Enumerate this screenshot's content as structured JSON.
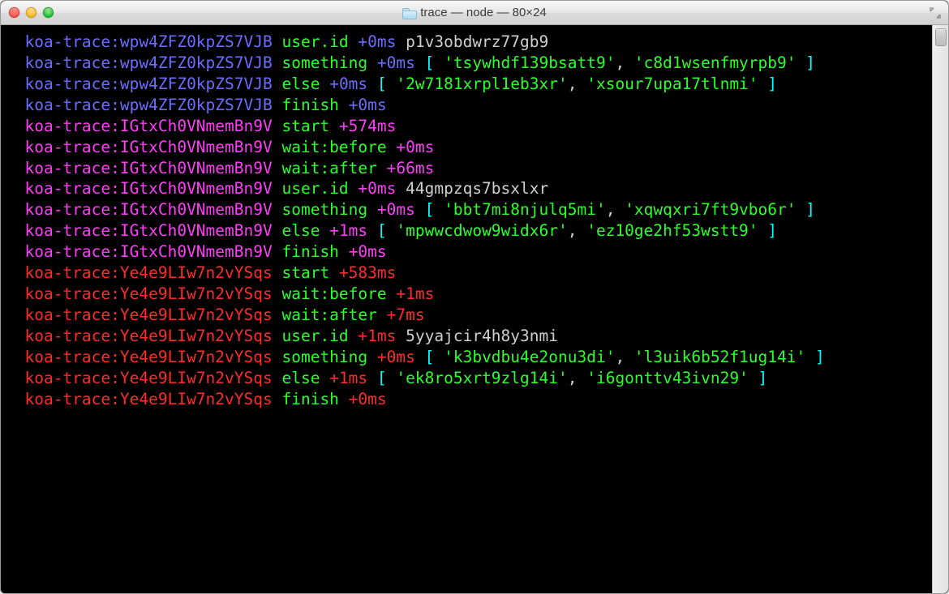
{
  "window": {
    "title": "trace — node — 80×24"
  },
  "colors": {
    "namespace_a": "#6a6dff",
    "namespace_b": "#ff3df8",
    "namespace_c": "#ff2b2b",
    "event": "#2bff2b",
    "timing_a": "#6a6dff",
    "timing_b": "#ff3df8",
    "timing_c": "#ff2b2b",
    "bracket": "#00ffff",
    "string": "#2bff2b",
    "plain": "#cfcfcf"
  },
  "log": [
    {
      "ns": "koa-trace:wpw4ZFZ0kpZS7VJB",
      "ns_color": "namespace_a",
      "event": "user.id",
      "timing": "+0ms",
      "payload_type": "plain",
      "plain": "p1v3obdwrz77gb9"
    },
    {
      "ns": "koa-trace:wpw4ZFZ0kpZS7VJB",
      "ns_color": "namespace_a",
      "event": "something",
      "timing": "+0ms",
      "payload_type": "array",
      "items": [
        "tsywhdf139bsatt9",
        "c8d1wsenfmyrpb9"
      ]
    },
    {
      "ns": "koa-trace:wpw4ZFZ0kpZS7VJB",
      "ns_color": "namespace_a",
      "event": "else",
      "timing": "+0ms",
      "payload_type": "array",
      "items": [
        "2w7181xrpl1eb3xr",
        "xsour7upa17tlnmi"
      ]
    },
    {
      "ns": "koa-trace:wpw4ZFZ0kpZS7VJB",
      "ns_color": "namespace_a",
      "event": "finish",
      "timing": "+0ms",
      "payload_type": "none"
    },
    {
      "ns": "koa-trace:IGtxCh0VNmemBn9V",
      "ns_color": "namespace_b",
      "event": "start",
      "timing": "+574ms",
      "payload_type": "none"
    },
    {
      "ns": "koa-trace:IGtxCh0VNmemBn9V",
      "ns_color": "namespace_b",
      "event": "wait:before",
      "timing": "+0ms",
      "payload_type": "none"
    },
    {
      "ns": "koa-trace:IGtxCh0VNmemBn9V",
      "ns_color": "namespace_b",
      "event": "wait:after",
      "timing": "+66ms",
      "payload_type": "none"
    },
    {
      "ns": "koa-trace:IGtxCh0VNmemBn9V",
      "ns_color": "namespace_b",
      "event": "user.id",
      "timing": "+0ms",
      "payload_type": "plain",
      "plain": "44gmpzqs7bsxlxr"
    },
    {
      "ns": "koa-trace:IGtxCh0VNmemBn9V",
      "ns_color": "namespace_b",
      "event": "something",
      "timing": "+0ms",
      "payload_type": "array",
      "items": [
        "bbt7mi8njulq5mi",
        "xqwqxri7ft9vbo6r"
      ]
    },
    {
      "ns": "koa-trace:IGtxCh0VNmemBn9V",
      "ns_color": "namespace_b",
      "event": "else",
      "timing": "+1ms",
      "payload_type": "array",
      "items": [
        "mpwwcdwow9widx6r",
        "ez10ge2hf53wstt9"
      ]
    },
    {
      "ns": "koa-trace:IGtxCh0VNmemBn9V",
      "ns_color": "namespace_b",
      "event": "finish",
      "timing": "+0ms",
      "payload_type": "none"
    },
    {
      "ns": "koa-trace:Ye4e9LIw7n2vYSqs",
      "ns_color": "namespace_c",
      "event": "start",
      "timing": "+583ms",
      "payload_type": "none"
    },
    {
      "ns": "koa-trace:Ye4e9LIw7n2vYSqs",
      "ns_color": "namespace_c",
      "event": "wait:before",
      "timing": "+1ms",
      "payload_type": "none"
    },
    {
      "ns": "koa-trace:Ye4e9LIw7n2vYSqs",
      "ns_color": "namespace_c",
      "event": "wait:after",
      "timing": "+7ms",
      "payload_type": "none"
    },
    {
      "ns": "koa-trace:Ye4e9LIw7n2vYSqs",
      "ns_color": "namespace_c",
      "event": "user.id",
      "timing": "+1ms",
      "payload_type": "plain",
      "plain": "5yyajcir4h8y3nmi"
    },
    {
      "ns": "koa-trace:Ye4e9LIw7n2vYSqs",
      "ns_color": "namespace_c",
      "event": "something",
      "timing": "+0ms",
      "payload_type": "array",
      "items": [
        "k3bvdbu4e2onu3di",
        "l3uik6b52f1ug14i"
      ]
    },
    {
      "ns": "koa-trace:Ye4e9LIw7n2vYSqs",
      "ns_color": "namespace_c",
      "event": "else",
      "timing": "+1ms",
      "payload_type": "array",
      "items": [
        "ek8ro5xrt9zlg14i",
        "i6gonttv43ivn29"
      ]
    },
    {
      "ns": "koa-trace:Ye4e9LIw7n2vYSqs",
      "ns_color": "namespace_c",
      "event": "finish",
      "timing": "+0ms",
      "payload_type": "none"
    }
  ]
}
